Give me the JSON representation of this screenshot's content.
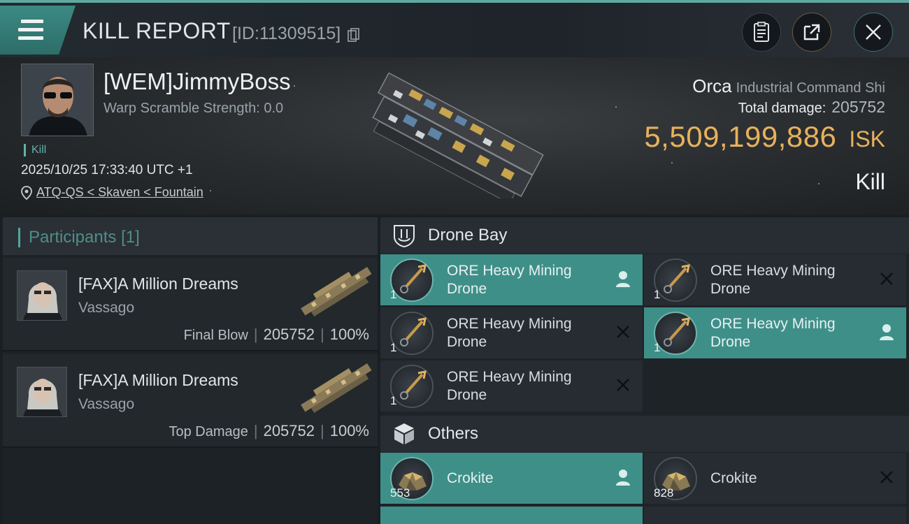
{
  "header": {
    "title": "KILL REPORT",
    "report_id": "[ID:11309515]",
    "icons": [
      "menu-icon",
      "copy-icon",
      "clipboard-icon",
      "share-icon",
      "close-icon"
    ]
  },
  "victim": {
    "name": "[WEM]JimmyBoss",
    "warp_scramble": "Warp Scramble Strength: 0.0",
    "kill_tag": "Kill",
    "datetime": "2025/10/25 17:33:40 UTC +1",
    "location": "ATQ-QS < Skaven < Fountain"
  },
  "ship": {
    "name": "Orca",
    "class": "Industrial Command Shi",
    "total_damage_label": "Total damage:",
    "total_damage": "205752",
    "isk_value": "5,509,199,886",
    "isk_unit": "ISK",
    "kill_type": "Kill"
  },
  "colors": {
    "accent_teal": "#3f8f89",
    "isk_gold": "#e7b25c"
  },
  "participants": {
    "title": "Participants",
    "count": "[1]",
    "rows": [
      {
        "name": "[FAX]A Million Dreams",
        "ship": "Vassago",
        "role": "Final Blow",
        "damage": "205752",
        "percent": "100%"
      },
      {
        "name": "[FAX]A Million Dreams",
        "ship": "Vassago",
        "role": "Top Damage",
        "damage": "205752",
        "percent": "100%"
      }
    ]
  },
  "drone_bay": {
    "title": "Drone Bay",
    "items": [
      {
        "line1": "ORE Heavy Mining",
        "line2": "Drone",
        "qty": "1",
        "status": "dropped"
      },
      {
        "line1": "ORE Heavy Mining",
        "line2": "Drone",
        "qty": "1",
        "status": "destroyed"
      },
      {
        "line1": "ORE Heavy Mining",
        "line2": "Drone",
        "qty": "1",
        "status": "destroyed"
      },
      {
        "line1": "ORE Heavy Mining",
        "line2": "Drone",
        "qty": "1",
        "status": "dropped"
      },
      {
        "line1": "ORE Heavy Mining",
        "line2": "Drone",
        "qty": "1",
        "status": "destroyed"
      }
    ]
  },
  "others": {
    "title": "Others",
    "items": [
      {
        "name": "Crokite",
        "qty": "553",
        "status": "dropped"
      },
      {
        "name": "Crokite",
        "qty": "828",
        "status": "destroyed"
      }
    ]
  }
}
